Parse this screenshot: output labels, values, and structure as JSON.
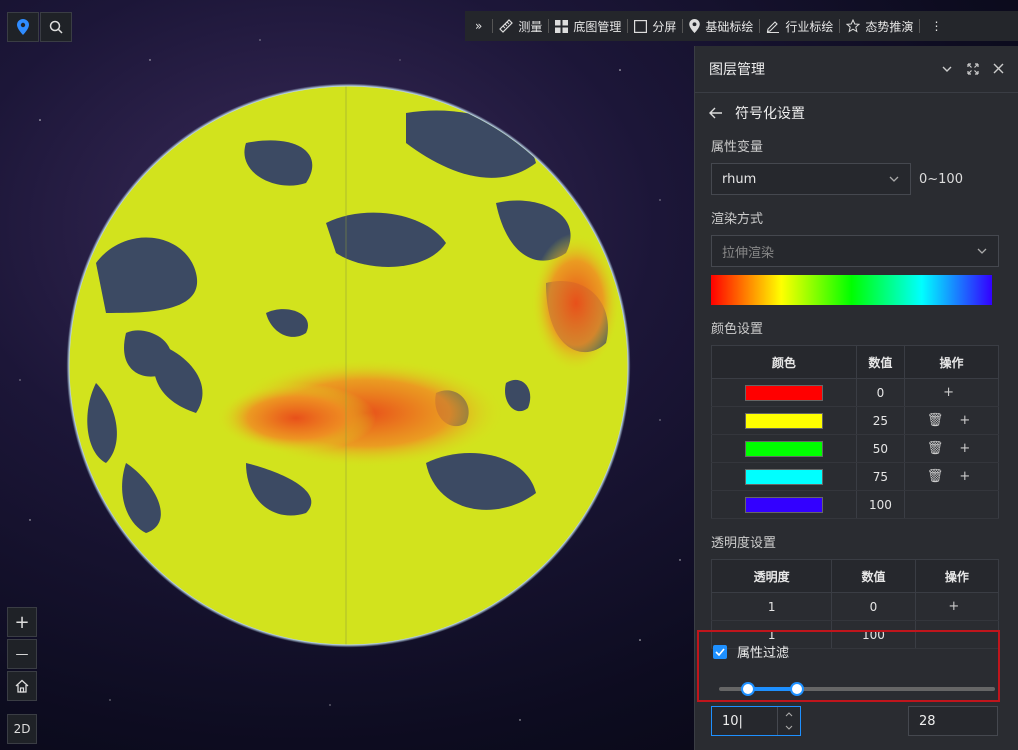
{
  "left_tools": {
    "location_icon": "location-pin-icon",
    "search_icon": "search-icon"
  },
  "map_controls": {
    "zoom_in": "+",
    "zoom_out": "—",
    "home_icon": "home-icon",
    "mode_label": "2D"
  },
  "toolbar": {
    "expand": "»",
    "items": [
      {
        "icon": "ruler-icon",
        "label": "测量"
      },
      {
        "icon": "grid-icon",
        "label": "底图管理"
      },
      {
        "icon": "square-icon",
        "label": "分屏"
      },
      {
        "icon": "location-pin-icon",
        "label": "基础标绘"
      },
      {
        "icon": "pen-icon",
        "label": "行业标绘"
      },
      {
        "icon": "star-icon",
        "label": "态势推演"
      }
    ],
    "more": "⋮"
  },
  "panel": {
    "title": "图层管理",
    "subtitle": "符号化设置",
    "attr_label": "属性变量",
    "attr_value": "rhum",
    "attr_range": "0~100",
    "render_label": "渲染方式",
    "render_value": "拉伸渲染",
    "color_label": "颜色设置",
    "color_table": {
      "headers": [
        "颜色",
        "数值",
        "操作"
      ],
      "rows": [
        {
          "color": "#ff0000",
          "value": "0",
          "ops": "+"
        },
        {
          "color": "#ffff00",
          "value": "25",
          "ops": "🗑 +"
        },
        {
          "color": "#00ff00",
          "value": "50",
          "ops": "🗑 +"
        },
        {
          "color": "#00ffff",
          "value": "75",
          "ops": "🗑 +"
        },
        {
          "color": "#3300ff",
          "value": "100",
          "ops": ""
        }
      ]
    },
    "opacity_label": "透明度设置",
    "opacity_table": {
      "headers": [
        "透明度",
        "数值",
        "操作"
      ],
      "rows": [
        {
          "opacity": "1",
          "value": "0",
          "ops": "+"
        },
        {
          "opacity": "1",
          "value": "100",
          "ops": ""
        }
      ]
    },
    "filter": {
      "label": "属性过滤",
      "checked": true,
      "min": 10,
      "max": 28,
      "min_text": "10",
      "max_text": "28"
    }
  }
}
